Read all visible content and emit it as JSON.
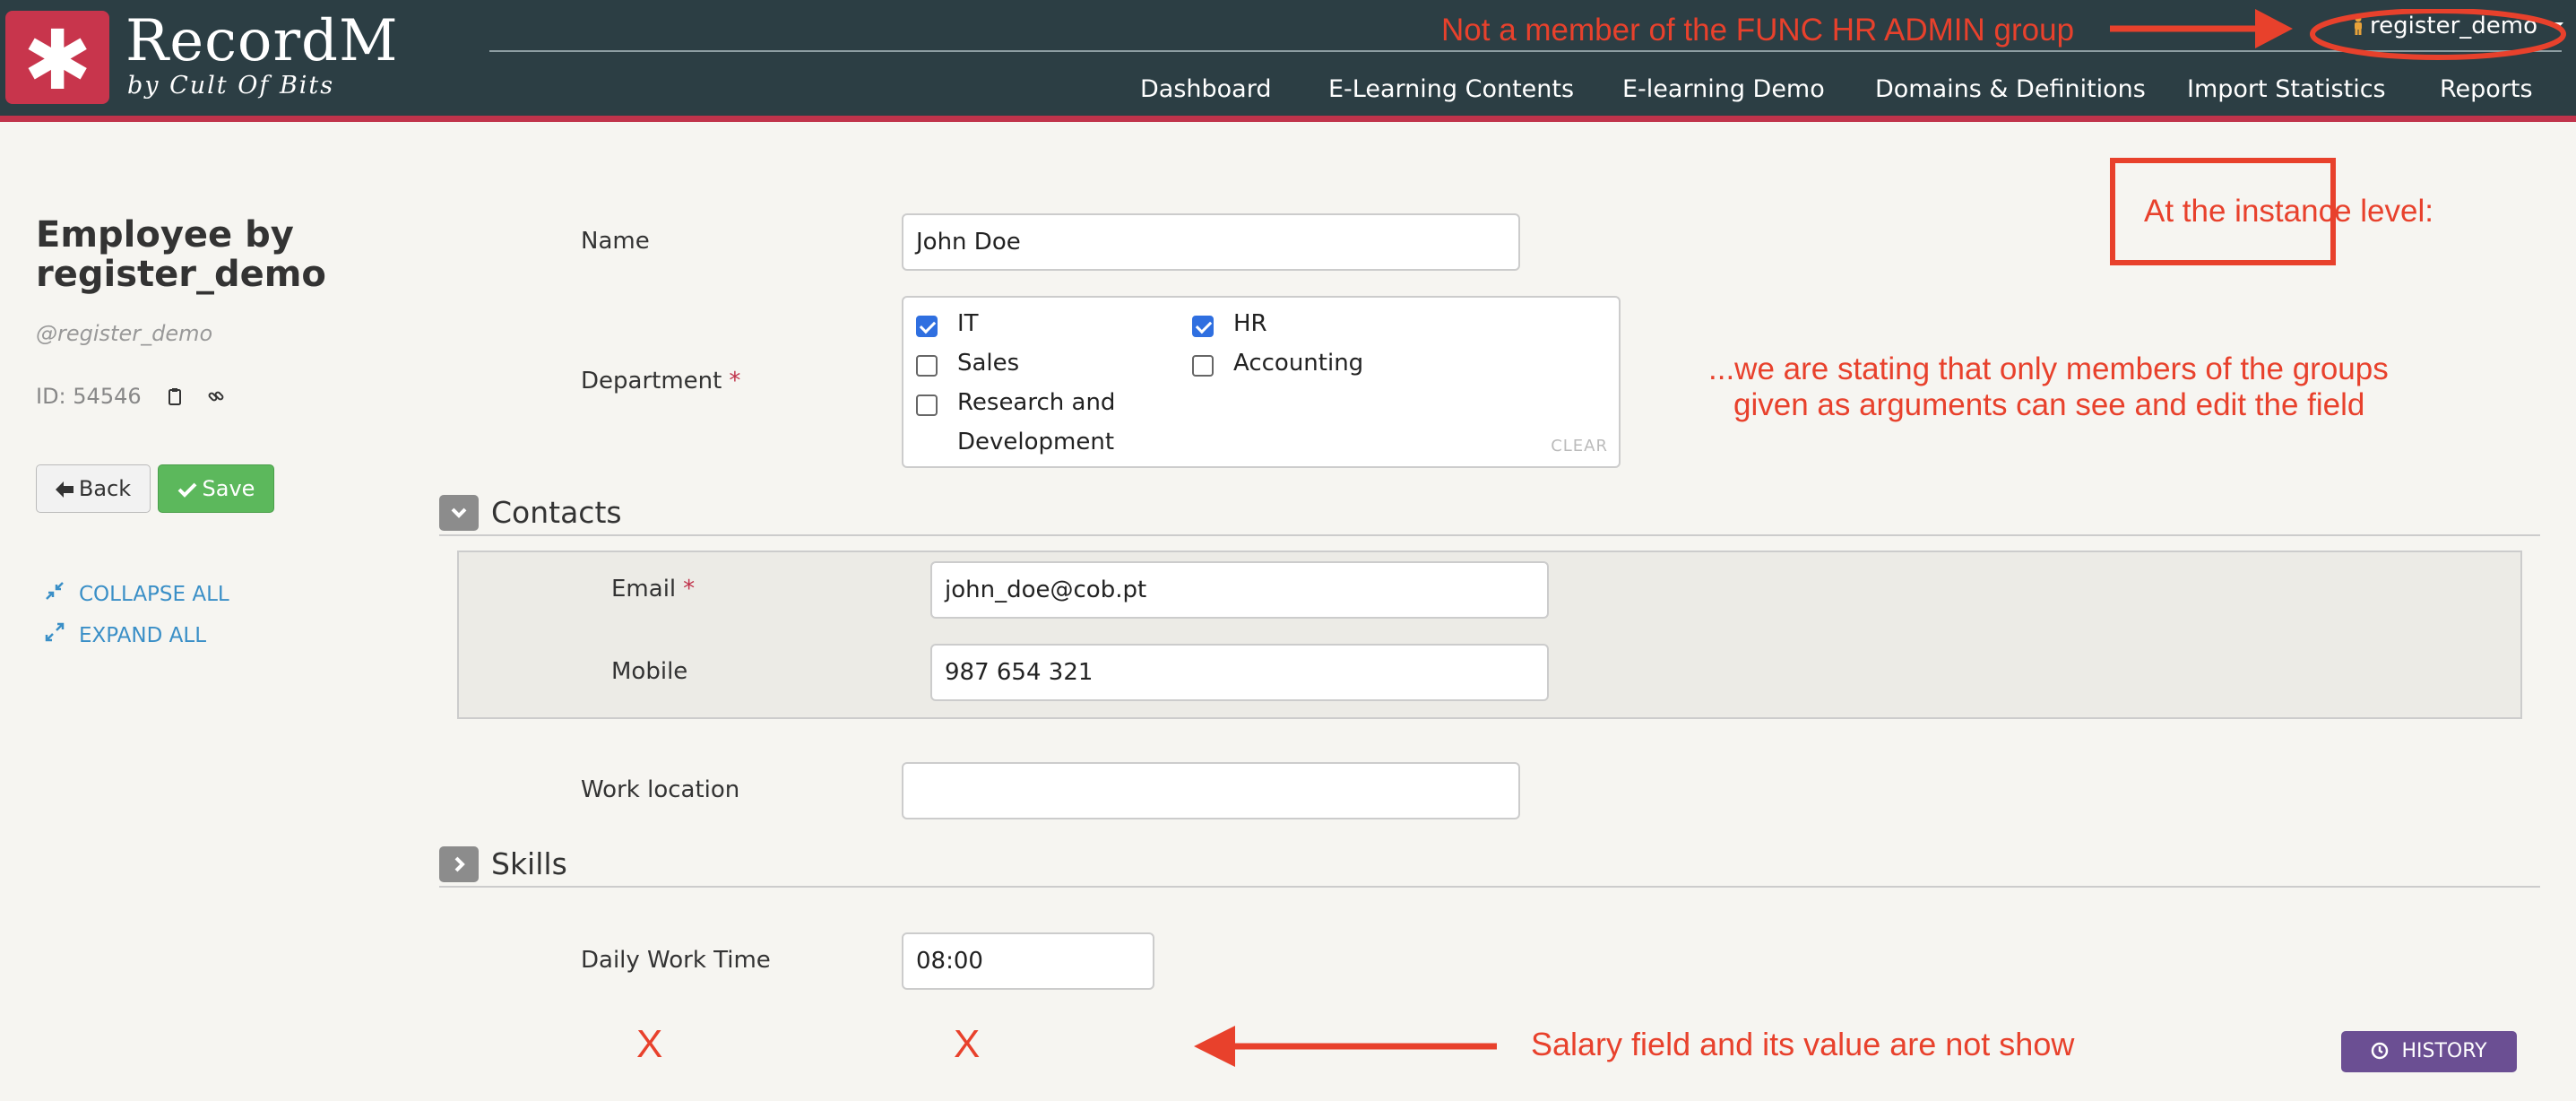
{
  "app": {
    "logo_glyph": "✱",
    "brand": "RecordM",
    "brand_sub": "by Cult Of Bits",
    "user": "register_demo",
    "nav": [
      "Dashboard",
      "E-Learning Contents",
      "E-learning Demo",
      "Domains & Definitions",
      "Import Statistics",
      "Reports"
    ]
  },
  "record": {
    "title_line1": "Employee by",
    "title_line2": "register_demo",
    "username": "@register_demo",
    "id_label": "ID: 54546"
  },
  "buttons": {
    "back": "Back",
    "save": "Save",
    "collapse_all": "COLLAPSE ALL",
    "expand_all": "EXPAND ALL",
    "history": "HISTORY"
  },
  "form": {
    "name_label": "Name",
    "name_value": "John Doe",
    "department_label": "Department",
    "required_mark": "*",
    "departments": [
      {
        "label": "IT",
        "checked": true
      },
      {
        "label": "Sales",
        "checked": false
      },
      {
        "label": "Research and",
        "label2": "Development",
        "checked": false
      },
      {
        "label": "HR",
        "checked": true
      },
      {
        "label": "Accounting",
        "checked": false
      }
    ],
    "clear_label": "CLEAR",
    "contacts_title": "Contacts",
    "email_label": "Email",
    "email_value": "john_doe@cob.pt",
    "mobile_label": "Mobile",
    "mobile_value": "987 654 321",
    "work_location_label": "Work location",
    "work_location_value": "",
    "skills_title": "Skills",
    "daily_work_time_label": "Daily Work Time",
    "daily_work_time_value": "08:00"
  },
  "annotations": {
    "not_member": "Not a member of the FUNC HR ADMIN group",
    "instance_level": "At the instance level:",
    "stating_line1": "...we are stating that only members of the groups",
    "stating_line2": "given as arguments can see and edit the field",
    "x_mark": "X",
    "salary_note": "Salary field and its value are not show"
  },
  "colors": {
    "header_bg": "#2c3e44",
    "accent_red": "#c0334b",
    "annotation_red": "#e8412c",
    "save_green": "#5cb85c",
    "history_purple": "#6b4f93",
    "link_blue": "#3a8fc7"
  }
}
